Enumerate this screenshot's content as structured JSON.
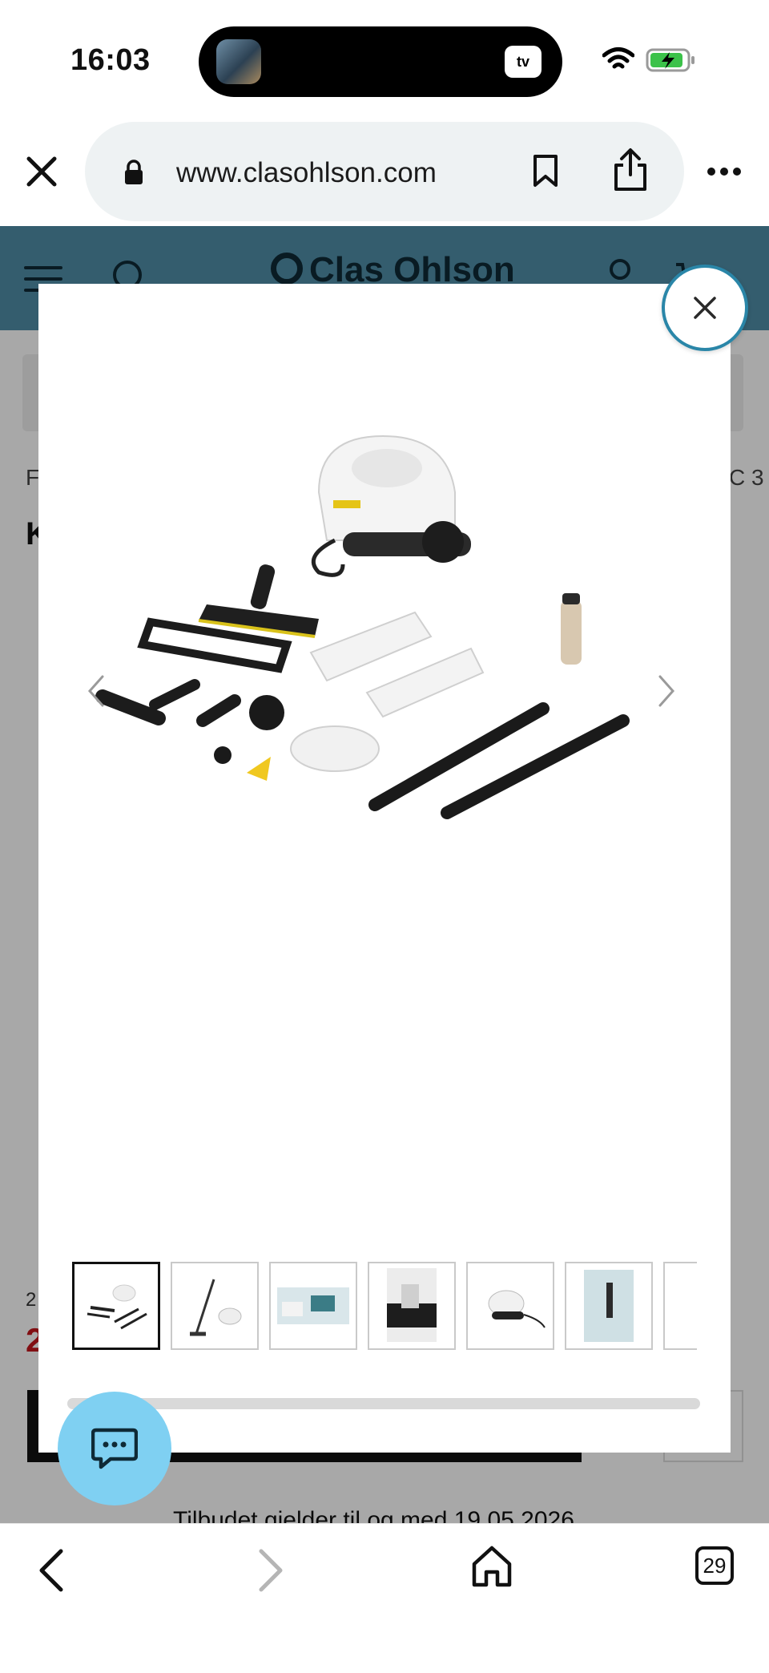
{
  "status_bar": {
    "time": "16:03",
    "island_app": "tv"
  },
  "browser": {
    "url": "www.clasohlson.com",
    "tab_count": "29"
  },
  "site_header": {
    "logo_text": "Clas Ohlson"
  },
  "background_page": {
    "crumb_left": "F",
    "crumb_right": "C 3",
    "title_fragment": "K",
    "old_price_fragment": "2",
    "price_fragment": "2",
    "offer_text": "Tilbudet gjelder til og med 19.05.2026"
  },
  "gallery": {
    "thumb_count_visible": 7,
    "active_index": 0,
    "scroll_progress": 0.03
  },
  "icons": {
    "close_tab": "close-icon",
    "lock": "lock-icon",
    "bookmark": "bookmark-icon",
    "share": "share-icon",
    "more": "more-icon",
    "menu": "hamburger-icon",
    "search": "search-icon",
    "account": "account-icon",
    "cart": "cart-icon",
    "modal_close": "close-icon",
    "prev": "chevron-left-icon",
    "next": "chevron-right-icon",
    "chat": "chat-icon",
    "back": "back-icon",
    "forward": "forward-icon",
    "home": "home-icon",
    "tabs": "tabs-icon"
  },
  "colors": {
    "header_blue": "#4f8ea8",
    "close_ring": "#2a86a8",
    "chat_blue": "#7fd0f2",
    "price_red": "#c4161c"
  }
}
